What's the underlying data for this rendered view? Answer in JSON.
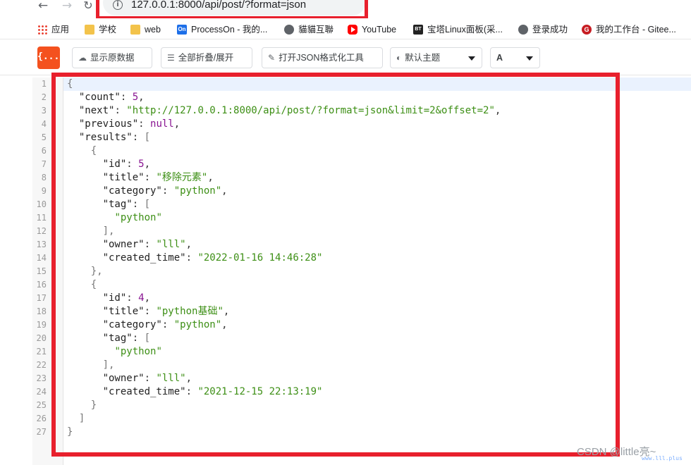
{
  "browser": {
    "url": "127.0.0.1:8000/api/post/?format=json"
  },
  "bookmarks": [
    {
      "label": "应用",
      "icon": "apps-grid-icon"
    },
    {
      "label": "学校",
      "icon": "folder-icon"
    },
    {
      "label": "web",
      "icon": "folder-icon"
    },
    {
      "label": "ProcessOn - 我的...",
      "icon": "processon-icon"
    },
    {
      "label": "貓貓互聯",
      "icon": "globe-icon"
    },
    {
      "label": "YouTube",
      "icon": "youtube-icon"
    },
    {
      "label": "宝塔Linux面板(采...",
      "icon": "bt-icon"
    },
    {
      "label": "登录成功",
      "icon": "globe-icon"
    },
    {
      "label": "我的工作台 - Gitee...",
      "icon": "gitee-icon"
    }
  ],
  "toolbar": {
    "logo": "{...}",
    "raw_label": "显示原数据",
    "fold_label": "全部折叠/展开",
    "format_label": "打开JSON格式化工具",
    "theme_label": "默认主题",
    "font_label": "A"
  },
  "json_view": {
    "line_numbers": [
      "1",
      "2",
      "3",
      "4",
      "5",
      "6",
      "7",
      "8",
      "9",
      "10",
      "11",
      "12",
      "13",
      "14",
      "15",
      "16",
      "17",
      "18",
      "19",
      "20",
      "21",
      "22",
      "23",
      "24",
      "25",
      "26",
      "27"
    ],
    "count_key": "\"count\"",
    "count_val": "5",
    "next_key": "\"next\"",
    "next_val": "\"http://127.0.0.1:8000/api/post/?format=json&limit=2&offset=2\"",
    "previous_key": "\"previous\"",
    "previous_val": "null",
    "results_key": "\"results\"",
    "items": [
      {
        "id_key": "\"id\"",
        "id_val": "5",
        "title_key": "\"title\"",
        "title_val": "\"移除元素\"",
        "category_key": "\"category\"",
        "category_val": "\"python\"",
        "tag_key": "\"tag\"",
        "tag_item": "\"python\"",
        "owner_key": "\"owner\"",
        "owner_val": "\"lll\"",
        "created_key": "\"created_time\"",
        "created_val": "\"2022-01-16 14:46:28\""
      },
      {
        "id_key": "\"id\"",
        "id_val": "4",
        "title_key": "\"title\"",
        "title_val": "\"python基础\"",
        "category_key": "\"category\"",
        "category_val": "\"python\"",
        "tag_key": "\"tag\"",
        "tag_item": "\"python\"",
        "owner_key": "\"owner\"",
        "owner_val": "\"lll\"",
        "created_key": "\"created_time\"",
        "created_val": "\"2021-12-15 22:13:19\""
      }
    ]
  },
  "watermark": {
    "text": "CSDN @little亮~",
    "sub": "www.lll.plus"
  },
  "colors": {
    "highlight": "#e8202d",
    "logo": "#f4511e",
    "string": "#3d8f15",
    "number": "#881391"
  }
}
